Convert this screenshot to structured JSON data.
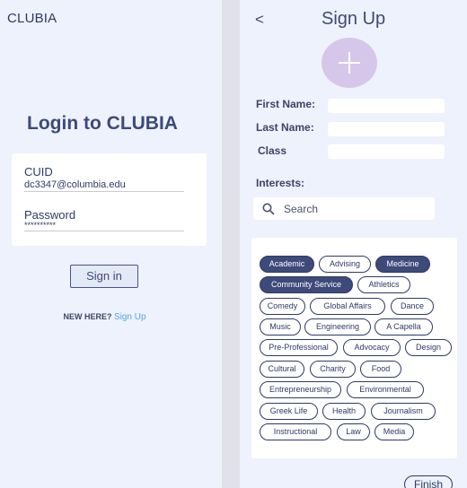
{
  "login": {
    "brand": "CLUBIA",
    "title": "Login to CLUBIA",
    "cuid_label": "CUID",
    "cuid_value": "dc3347@columbia.edu",
    "password_label": "Password",
    "password_value": "**********",
    "signin_label": "Sign in",
    "new_here": "NEW HERE?",
    "signup_link": "Sign Up"
  },
  "signup": {
    "back": "<",
    "title": "Sign Up",
    "first_name_label": "First Name:",
    "last_name_label": "Last Name:",
    "class_label": "Class",
    "interests_label": "Interests:",
    "search_placeholder": "Search",
    "finish_label": "Finish",
    "interests": [
      {
        "label": "Academic",
        "selected": true
      },
      {
        "label": "Advising",
        "selected": false
      },
      {
        "label": "Medicine",
        "selected": true
      },
      {
        "label": "Community Service",
        "selected": true
      },
      {
        "label": "Athletics",
        "selected": false
      },
      {
        "label": "Comedy",
        "selected": false
      },
      {
        "label": "Global Affairs",
        "selected": false
      },
      {
        "label": "Dance",
        "selected": false
      },
      {
        "label": "Music",
        "selected": false
      },
      {
        "label": "Engineering",
        "selected": false
      },
      {
        "label": "A Capella",
        "selected": false
      },
      {
        "label": "Pre-Professional",
        "selected": false
      },
      {
        "label": "Advocacy",
        "selected": false
      },
      {
        "label": "Design",
        "selected": false
      },
      {
        "label": "Cultural",
        "selected": false
      },
      {
        "label": "Charity",
        "selected": false
      },
      {
        "label": "Food",
        "selected": false
      },
      {
        "label": "Entrepreneurship",
        "selected": false
      },
      {
        "label": "Environmental",
        "selected": false
      },
      {
        "label": "Greek Life",
        "selected": false
      },
      {
        "label": "Health",
        "selected": false
      },
      {
        "label": "Journalism",
        "selected": false
      },
      {
        "label": "Instructional",
        "selected": false
      },
      {
        "label": "Law",
        "selected": false
      },
      {
        "label": "Media",
        "selected": false
      }
    ]
  },
  "colors": {
    "primary": "#3d4a7a",
    "background": "#eef2fc",
    "avatar": "#d6c7ea",
    "link": "#56a8de"
  }
}
